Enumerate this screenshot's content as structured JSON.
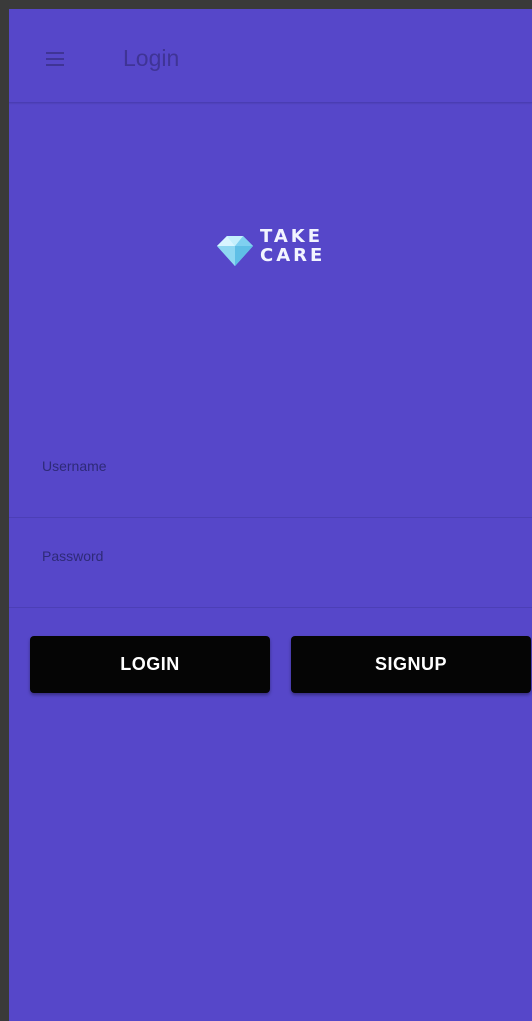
{
  "toolbar": {
    "title": "Login",
    "menu_icon": "hamburger-menu-icon"
  },
  "logo": {
    "line1": "TAKE",
    "line2": "CARE",
    "icon": "gem-logo-icon"
  },
  "form": {
    "username_label": "Username",
    "password_label": "Password"
  },
  "buttons": {
    "login_label": "LOGIN",
    "signup_label": "SIGNUP"
  },
  "colors": {
    "background": "#5647c9",
    "toolbar_text": "#3f3496",
    "button": "#050505",
    "button_text": "#ffffff",
    "logo_accent": "#7fd0f0"
  }
}
